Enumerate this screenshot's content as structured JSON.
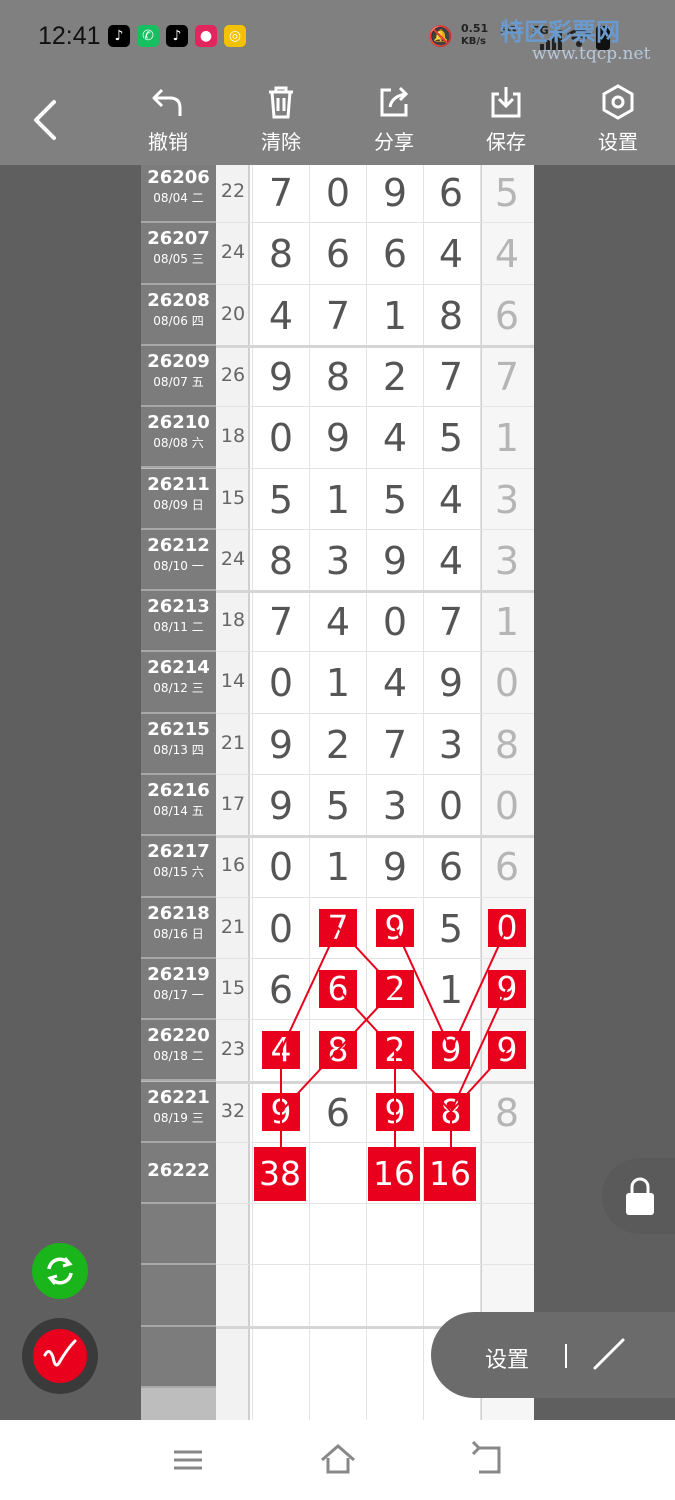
{
  "status_bar": {
    "time": "12:41",
    "net_speed": "0.51",
    "net_unit": "KB/s",
    "signal1": "5G",
    "signal2": "5G"
  },
  "watermark": {
    "name": "特区彩票网",
    "url": "www.tqcp.net"
  },
  "toolbar": {
    "undo_label": "撤销",
    "clear_label": "清除",
    "share_label": "分享",
    "save_label": "保存",
    "settings_label": "设置"
  },
  "rows": [
    {
      "issue": "26206",
      "date": "08/04 二",
      "sum": "22",
      "digits": [
        "7",
        "0",
        "9",
        "6",
        "5"
      ]
    },
    {
      "issue": "26207",
      "date": "08/05 三",
      "sum": "24",
      "digits": [
        "8",
        "6",
        "6",
        "4",
        "4"
      ]
    },
    {
      "issue": "26208",
      "date": "08/06 四",
      "sum": "20",
      "digits": [
        "4",
        "7",
        "1",
        "8",
        "6"
      ]
    },
    {
      "issue": "26209",
      "date": "08/07 五",
      "sum": "26",
      "digits": [
        "9",
        "8",
        "2",
        "7",
        "7"
      ]
    },
    {
      "issue": "26210",
      "date": "08/08 六",
      "sum": "18",
      "digits": [
        "0",
        "9",
        "4",
        "5",
        "1"
      ]
    },
    {
      "issue": "26211",
      "date": "08/09 日",
      "sum": "15",
      "digits": [
        "5",
        "1",
        "5",
        "4",
        "3"
      ]
    },
    {
      "issue": "26212",
      "date": "08/10 一",
      "sum": "24",
      "digits": [
        "8",
        "3",
        "9",
        "4",
        "3"
      ]
    },
    {
      "issue": "26213",
      "date": "08/11 二",
      "sum": "18",
      "digits": [
        "7",
        "4",
        "0",
        "7",
        "1"
      ]
    },
    {
      "issue": "26214",
      "date": "08/12 三",
      "sum": "14",
      "digits": [
        "0",
        "1",
        "4",
        "9",
        "0"
      ]
    },
    {
      "issue": "26215",
      "date": "08/13 四",
      "sum": "21",
      "digits": [
        "9",
        "2",
        "7",
        "3",
        "8"
      ]
    },
    {
      "issue": "26216",
      "date": "08/14 五",
      "sum": "17",
      "digits": [
        "9",
        "5",
        "3",
        "0",
        "0"
      ]
    },
    {
      "issue": "26217",
      "date": "08/15 六",
      "sum": "16",
      "digits": [
        "0",
        "1",
        "9",
        "6",
        "6"
      ]
    },
    {
      "issue": "26218",
      "date": "08/16 日",
      "sum": "21",
      "digits": [
        "0",
        "7",
        "9",
        "5",
        "0"
      ]
    },
    {
      "issue": "26219",
      "date": "08/17 一",
      "sum": "15",
      "digits": [
        "6",
        "6",
        "2",
        "1",
        "9"
      ]
    },
    {
      "issue": "26220",
      "date": "08/18 二",
      "sum": "23",
      "digits": [
        "4",
        "8",
        "2",
        "9",
        "9"
      ]
    },
    {
      "issue": "26221",
      "date": "08/19 三",
      "sum": "32",
      "digits": [
        "9",
        "6",
        "9",
        "8",
        "8"
      ]
    },
    {
      "issue": "26222",
      "date": "",
      "sum": "",
      "digits": [
        "",
        "",
        "",
        "",
        ""
      ]
    }
  ],
  "sum_boxes": [
    "38",
    "16",
    "16"
  ],
  "settings_pill": {
    "label": "设置"
  },
  "colors": {
    "highlight": "#e8001c",
    "toolbar": "#808080",
    "refresh": "#1ab51a"
  }
}
